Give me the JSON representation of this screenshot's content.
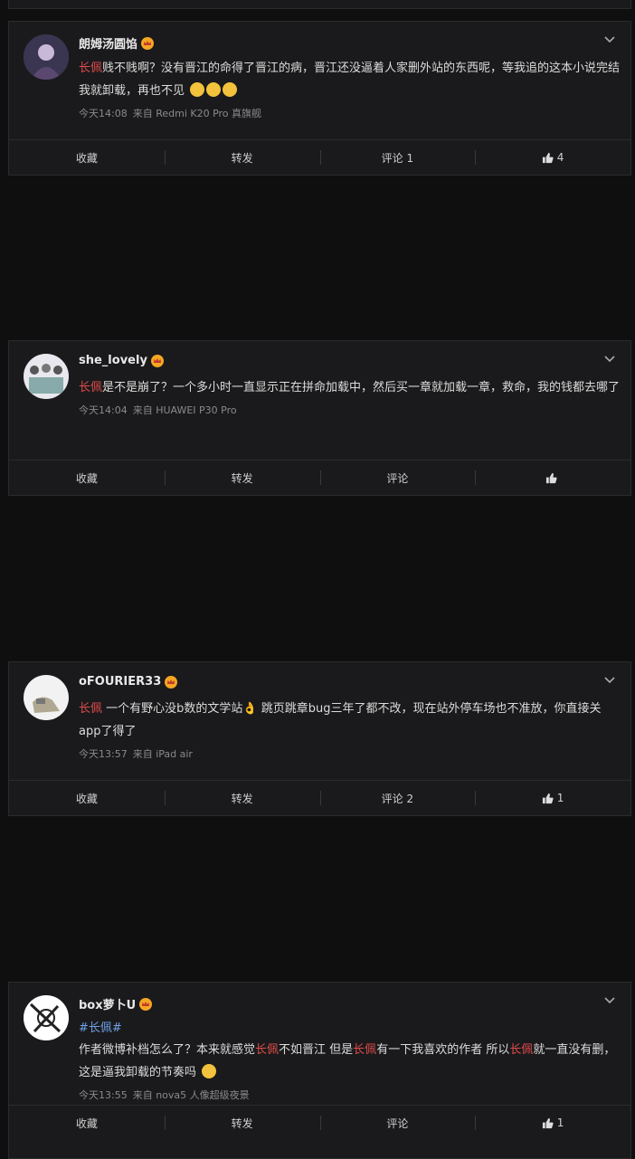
{
  "posts": [
    {
      "username": "朗姆汤圆馅",
      "segments": [
        {
          "t": "长佩",
          "hl": "tag"
        },
        {
          "t": "贱不贱啊？没有晋江的命得了晋江的病，晋江还没逼着人家删外站的东西呢，等我追的这本小说完结我就卸载，再也不见",
          "hl": ""
        }
      ],
      "emoji_count": 3,
      "time": "今天14:08",
      "source": "来自 Redmi K20 Pro 真旗舰",
      "actions": {
        "favorite": "收藏",
        "repost": "转发",
        "comment": "评论 1",
        "likes": "4"
      }
    },
    {
      "username": "she_lovely",
      "segments": [
        {
          "t": "长佩",
          "hl": "tag"
        },
        {
          "t": "是不是崩了？一个多小时一直显示正在拼命加载中，然后买一章就加载一章，救命，我的钱都去哪了",
          "hl": ""
        }
      ],
      "emoji_count": 0,
      "time": "今天14:04",
      "source": "来自 HUAWEI P30 Pro",
      "actions": {
        "favorite": "收藏",
        "repost": "转发",
        "comment": "评论",
        "likes": ""
      }
    },
    {
      "username": "oFOURIER33",
      "segments": [
        {
          "t": "长佩",
          "hl": "tag"
        },
        {
          "t": " 一个有野心没b数的文学站",
          "hl": ""
        },
        {
          "t": "👌",
          "hl": "emoji"
        },
        {
          "t": " 跳页跳章bug三年了都不改，现在站外停车场也不准放，你直接关app了得了",
          "hl": ""
        }
      ],
      "emoji_count": 0,
      "time": "今天13:57",
      "source": "来自 iPad air",
      "actions": {
        "favorite": "收藏",
        "repost": "转发",
        "comment": "评论 2",
        "likes": "1"
      }
    },
    {
      "username": "box萝卜U",
      "hashtag": "#长佩#",
      "segments": [
        {
          "t": "作者微博补档怎么了？本来就感觉",
          "hl": ""
        },
        {
          "t": "长佩",
          "hl": "tag"
        },
        {
          "t": "不如晋江 但是",
          "hl": ""
        },
        {
          "t": "长佩",
          "hl": "tag"
        },
        {
          "t": "有一下我喜欢的作者 所以",
          "hl": ""
        },
        {
          "t": "长佩",
          "hl": "tag"
        },
        {
          "t": "就一直没有删，这是逼我卸载的节奏吗",
          "hl": ""
        }
      ],
      "emoji_count": 1,
      "time": "今天13:55",
      "source": "来自 nova5 人像超级夜景",
      "actions": {
        "favorite": "收藏",
        "repost": "转发",
        "comment": "评论",
        "likes": "1"
      }
    }
  ],
  "colors": {
    "accent_red": "#e04b4b",
    "hashtag_blue": "#6fa0e8",
    "background": "#1a1a1c"
  },
  "icons": [
    "crown-badge-icon",
    "chevron-down-icon",
    "thumbs-up-icon",
    "emoji-icon"
  ]
}
